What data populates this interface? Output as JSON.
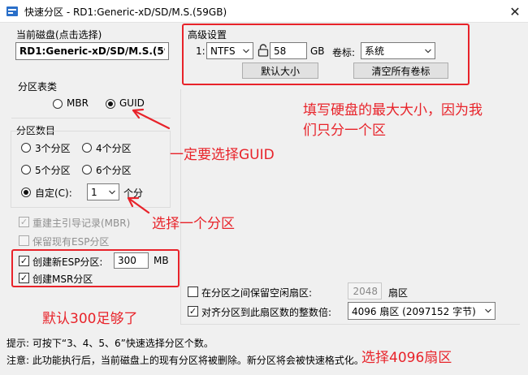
{
  "window": {
    "title": "快速分区 - RD1:Generic-xD/SD/M.S.(59GB)",
    "close_glyph": "✕"
  },
  "disk": {
    "label": "当前磁盘(点击选择)",
    "name": "RD1:Generic-xD/SD/M.S.(59GB"
  },
  "partition_table": {
    "label": "分区表类",
    "options": [
      "MBR",
      "GUID"
    ],
    "selected": "GUID"
  },
  "partition_count": {
    "label": "分区数目",
    "options": [
      "3个分区",
      "4个分区",
      "5个分区",
      "6个分区"
    ],
    "custom_label": "自定(C):",
    "custom_value": "1",
    "custom_unit": "个分"
  },
  "options": {
    "rebuild_mbr": "重建主引导记录(MBR)",
    "keep_esp": "保留现有ESP分区",
    "create_esp": "创建新ESP分区:",
    "esp_size": "300",
    "esp_unit": "MB",
    "create_msr": "创建MSR分区"
  },
  "advanced": {
    "label": "高级设置",
    "row_index": "1:",
    "fs": "NTFS",
    "size": "58",
    "size_unit": "GB",
    "volume_label_label": "卷标:",
    "volume_label": "系统",
    "default_size_button": "默认大小",
    "clear_labels_button": "清空所有卷标"
  },
  "align": {
    "keep_free_label": "在分区之间保留空闲扇区:",
    "keep_free_value": "2048",
    "keep_free_unit": "扇区",
    "align_label": "对齐分区到此扇区数的整数倍:",
    "align_value": "4096 扇区 (2097152 字节)"
  },
  "hints": {
    "tip": "提示: 可按下“3、4、5、6”快速选择分区个数。",
    "note": "注意: 此功能执行后，当前磁盘上的现有分区将被删除。新分区将会被快速格式化。"
  },
  "annotations": {
    "max_size": "填写硬盘的最大大小，因为我们只分一个区",
    "max_size_line1": "填写硬盘的最大大小，因为我",
    "max_size_line2": "们只分一个区",
    "guid": "一定要选择GUID",
    "one_partition": "选择一个分区",
    "default_300": "默认300足够了",
    "sector_4096": "选择4096扇区"
  },
  "colors": {
    "annotation": "#e8232a",
    "window_bg": "#f0f0f0"
  }
}
